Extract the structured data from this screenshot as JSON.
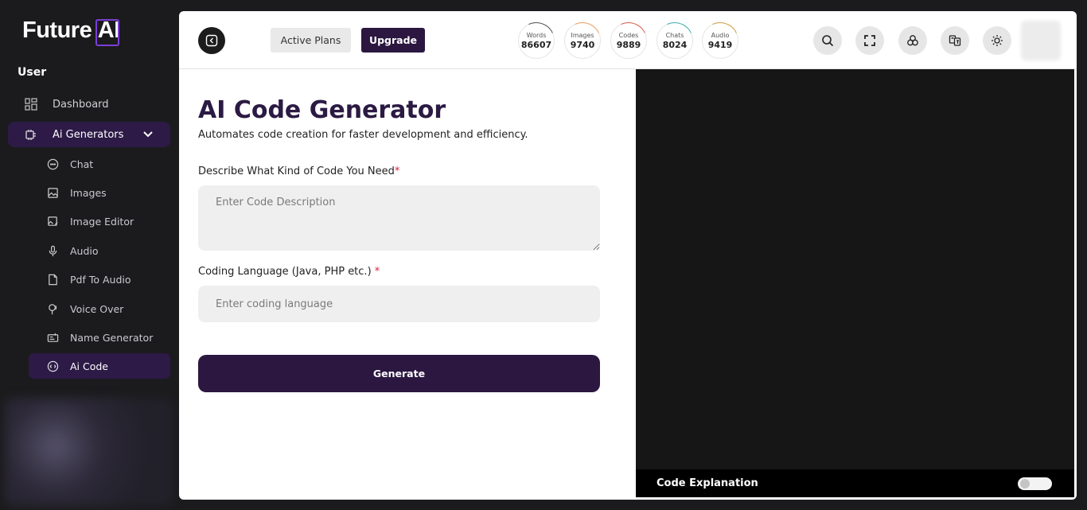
{
  "brand": {
    "name_part1": "Future ",
    "name_part2": "AI"
  },
  "sidebar": {
    "section": "User",
    "items": [
      {
        "label": "Dashboard",
        "icon": "dashboard-icon"
      },
      {
        "label": "Ai Generators",
        "icon": "ai-generators-icon",
        "expanded": true
      }
    ],
    "subitems": [
      {
        "label": "Chat",
        "icon": "chat-icon"
      },
      {
        "label": "Images",
        "icon": "image-icon"
      },
      {
        "label": "Image Editor",
        "icon": "image-editor-icon"
      },
      {
        "label": "Audio",
        "icon": "microphone-icon"
      },
      {
        "label": "Pdf To Audio",
        "icon": "pdf-icon"
      },
      {
        "label": "Voice Over",
        "icon": "voice-over-icon"
      },
      {
        "label": "Name Generator",
        "icon": "name-generator-icon"
      },
      {
        "label": "Ai Code",
        "icon": "code-icon",
        "active": true
      }
    ]
  },
  "topbar": {
    "active_plans": "Active Plans",
    "upgrade": "Upgrade",
    "stats": [
      {
        "label": "Words",
        "value": "86607",
        "color": "#555555"
      },
      {
        "label": "Images",
        "value": "9740",
        "color": "#f0a060"
      },
      {
        "label": "Codes",
        "value": "9889",
        "color": "#e06050"
      },
      {
        "label": "Chats",
        "value": "8024",
        "color": "#40b0b0"
      },
      {
        "label": "Audio",
        "value": "9419",
        "color": "#d0a040"
      }
    ],
    "tools": [
      "search-icon",
      "fullscreen-icon",
      "integrations-icon",
      "translate-icon",
      "theme-toggle-icon"
    ]
  },
  "form": {
    "title": "AI Code Generator",
    "description": "Automates code creation for faster development and efficiency.",
    "code_label": "Describe What Kind of Code You Need",
    "code_required": "*",
    "code_placeholder": "Enter Code Description",
    "language_label": "Coding Language (Java, PHP etc.) ",
    "language_required": "*",
    "language_placeholder": "Enter coding language",
    "generate_label": "Generate"
  },
  "output": {
    "explanation_label": "Code Explanation",
    "explanation_enabled": false
  }
}
